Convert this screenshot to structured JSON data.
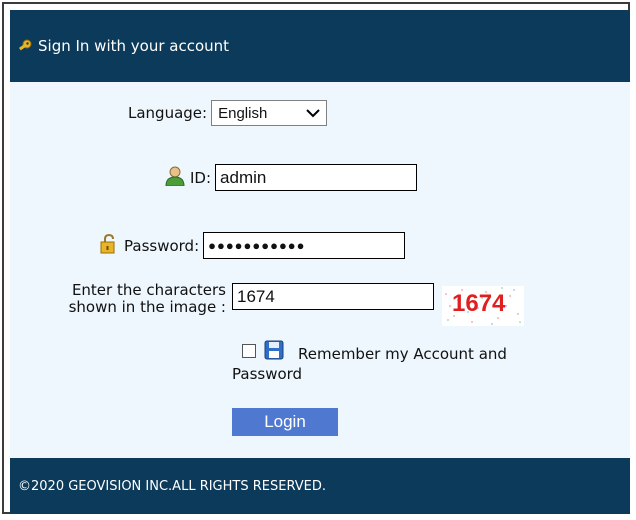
{
  "header": {
    "title": "Sign In with your account"
  },
  "form": {
    "language_label": "Language:",
    "language_value": "English",
    "id_label": "ID:",
    "id_value": "admin",
    "password_label": "Password:",
    "password_value": "●●●●●●●●●●●",
    "captcha_label_line1": "Enter the characters",
    "captcha_label_line2": "shown in the image :",
    "captcha_input_value": "1674",
    "captcha_image_text": "1674",
    "remember_line1": "Remember my Account and",
    "remember_line2": "Password",
    "login_label": "Login"
  },
  "footer": {
    "copyright": "©2020 GEOVISION INC.ALL RIGHTS RESERVED."
  },
  "colors": {
    "header_bg": "#0b3a5a",
    "body_bg": "#eef7fd",
    "login_button": "#4f79d1"
  },
  "icons": [
    "key-icon",
    "user-icon",
    "lock-icon",
    "save-icon",
    "chevron-down-icon"
  ]
}
